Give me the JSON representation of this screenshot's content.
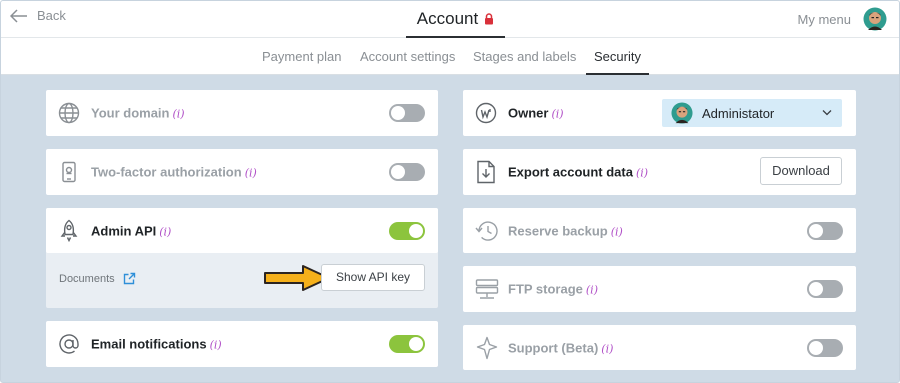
{
  "header": {
    "back_label": "Back",
    "title": "Account",
    "menu_label": "My menu"
  },
  "tabs": [
    {
      "label": "Payment plan",
      "active": false
    },
    {
      "label": "Account settings",
      "active": false
    },
    {
      "label": "Stages and labels",
      "active": false
    },
    {
      "label": "Security",
      "active": true
    }
  ],
  "left": {
    "domain": {
      "label": "Your domain",
      "info": "(i)",
      "enabled": false
    },
    "two_factor": {
      "label": "Two-factor authorization",
      "info": "(i)",
      "enabled": false
    },
    "admin_api": {
      "label": "Admin API",
      "info": "(i)",
      "enabled": true,
      "docs_label": "Documents",
      "key_button": "Show API key"
    },
    "email": {
      "label": "Email notifications",
      "info": "(i)",
      "enabled": true
    }
  },
  "right": {
    "owner": {
      "label": "Owner",
      "info": "(i)",
      "selected": "Administator"
    },
    "export": {
      "label": "Export account data",
      "info": "(i)",
      "button": "Download"
    },
    "backup": {
      "label": "Reserve backup",
      "info": "(i)",
      "enabled": false
    },
    "ftp": {
      "label": "FTP storage",
      "info": "(i)",
      "enabled": false
    },
    "support": {
      "label": "Support (Beta)",
      "info": "(i)",
      "enabled": false
    }
  },
  "colors": {
    "accent_on": "#8cc43d",
    "toggle_off": "#a8adb2",
    "info": "#b04fc7",
    "arrow": "#f5b01a",
    "background": "#cfdbe6",
    "owner_select": "#d6ebf8"
  },
  "icons": [
    "arrow-left-icon",
    "lock-icon",
    "avatar",
    "globe-icon",
    "phone-icon",
    "rocket-icon",
    "external-link-icon",
    "at-icon",
    "owner-icon",
    "file-download-icon",
    "history-icon",
    "server-icon",
    "sparkle-icon",
    "chevron-down-icon",
    "pointer-arrow"
  ]
}
